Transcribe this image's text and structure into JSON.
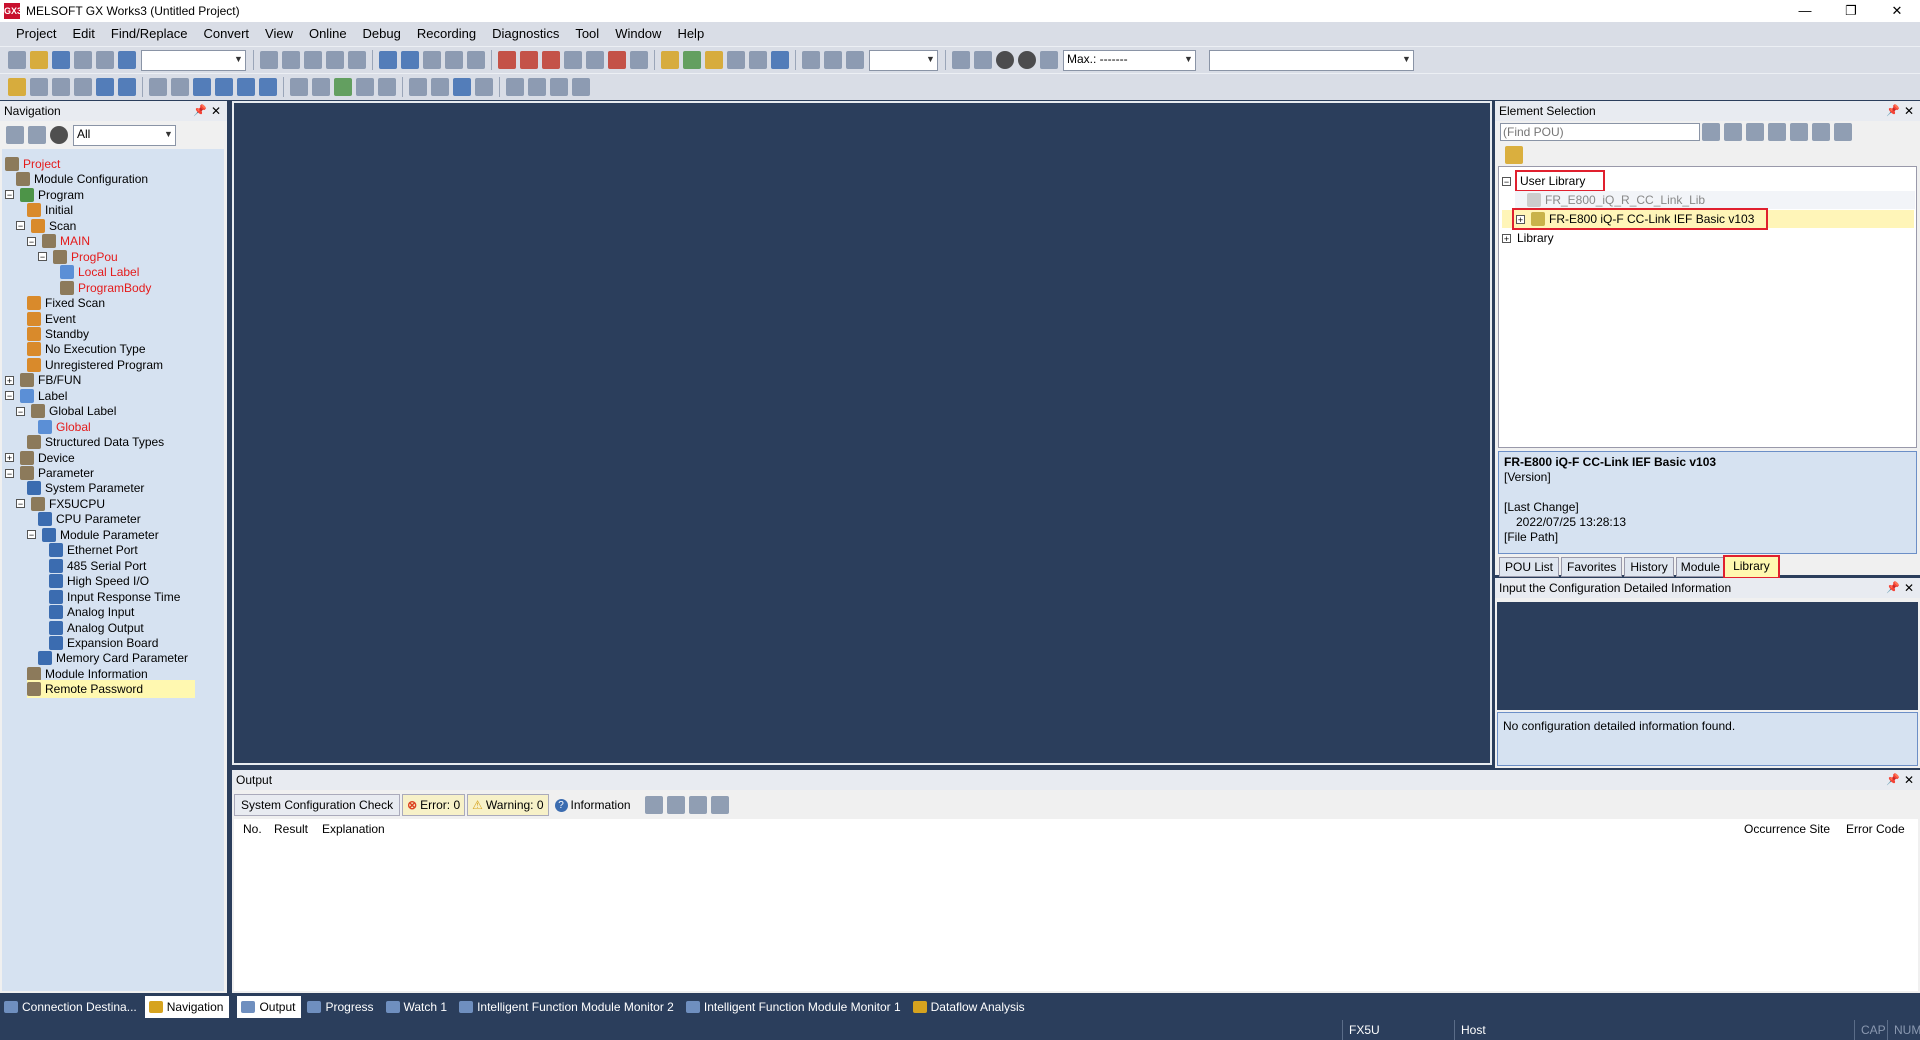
{
  "window": {
    "title": "MELSOFT GX Works3 (Untitled Project)",
    "app_icon": "GX3"
  },
  "menu": [
    "Project",
    "Edit",
    "Find/Replace",
    "Convert",
    "View",
    "Online",
    "Debug",
    "Recording",
    "Diagnostics",
    "Tool",
    "Window",
    "Help"
  ],
  "toolbar": {
    "monitor_label": "Max.: -------"
  },
  "navigation": {
    "title": "Navigation",
    "filter_value": "All",
    "tree": [
      {
        "label": "Project",
        "level": 0,
        "expander": "",
        "icon": "project-icon",
        "red": true
      },
      {
        "label": "Module Configuration",
        "level": 1,
        "expander": "",
        "icon": "module-config-icon",
        "red": false
      },
      {
        "label": "Program",
        "level": 0,
        "expander": "−",
        "icon": "program-icon",
        "red": false
      },
      {
        "label": "Initial",
        "level": 2,
        "expander": "",
        "icon": "folder-icon",
        "red": false
      },
      {
        "label": "Scan",
        "level": 1,
        "expander": "−",
        "icon": "folder-icon",
        "red": false
      },
      {
        "label": "MAIN",
        "level": 2,
        "expander": "−",
        "icon": "program-file-icon",
        "red": true
      },
      {
        "label": "ProgPou",
        "level": 3,
        "expander": "−",
        "icon": "pou-icon",
        "red": true
      },
      {
        "label": "Local Label",
        "level": 5,
        "expander": "",
        "icon": "label-icon",
        "red": true
      },
      {
        "label": "ProgramBody",
        "level": 5,
        "expander": "",
        "icon": "body-icon",
        "red": true
      },
      {
        "label": "Fixed Scan",
        "level": 2,
        "expander": "",
        "icon": "folder-icon",
        "red": false
      },
      {
        "label": "Event",
        "level": 2,
        "expander": "",
        "icon": "folder-icon",
        "red": false
      },
      {
        "label": "Standby",
        "level": 2,
        "expander": "",
        "icon": "folder-icon",
        "red": false
      },
      {
        "label": "No Execution Type",
        "level": 2,
        "expander": "",
        "icon": "folder-icon",
        "red": false
      },
      {
        "label": "Unregistered Program",
        "level": 2,
        "expander": "",
        "icon": "folder-icon",
        "red": false
      },
      {
        "label": "FB/FUN",
        "level": 0,
        "expander": "+",
        "icon": "fbfun-icon",
        "red": false
      },
      {
        "label": "Label",
        "level": 0,
        "expander": "−",
        "icon": "label-icon",
        "red": false
      },
      {
        "label": "Global Label",
        "level": 1,
        "expander": "−",
        "icon": "global-label-icon",
        "red": false
      },
      {
        "label": "Global",
        "level": 3,
        "expander": "",
        "icon": "label-icon",
        "red": true
      },
      {
        "label": "Structured Data Types",
        "level": 2,
        "expander": "",
        "icon": "struct-icon",
        "red": false
      },
      {
        "label": "Device",
        "level": 0,
        "expander": "+",
        "icon": "device-icon",
        "red": false
      },
      {
        "label": "Parameter",
        "level": 0,
        "expander": "−",
        "icon": "parameter-icon",
        "red": false
      },
      {
        "label": "System Parameter",
        "level": 2,
        "expander": "",
        "icon": "param-icon",
        "red": false
      },
      {
        "label": "FX5UCPU",
        "level": 1,
        "expander": "−",
        "icon": "cpu-icon",
        "red": false
      },
      {
        "label": "CPU Parameter",
        "level": 3,
        "expander": "",
        "icon": "param-icon",
        "red": false
      },
      {
        "label": "Module Parameter",
        "level": 2,
        "expander": "−",
        "icon": "param-icon",
        "red": false
      },
      {
        "label": "Ethernet Port",
        "level": 4,
        "expander": "",
        "icon": "param-icon",
        "red": false
      },
      {
        "label": "485 Serial Port",
        "level": 4,
        "expander": "",
        "icon": "param-icon",
        "red": false
      },
      {
        "label": "High Speed I/O",
        "level": 4,
        "expander": "",
        "icon": "param-icon",
        "red": false
      },
      {
        "label": "Input Response Time",
        "level": 4,
        "expander": "",
        "icon": "param-icon",
        "red": false
      },
      {
        "label": "Analog Input",
        "level": 4,
        "expander": "",
        "icon": "param-icon",
        "red": false
      },
      {
        "label": "Analog Output",
        "level": 4,
        "expander": "",
        "icon": "param-icon",
        "red": false
      },
      {
        "label": "Expansion Board",
        "level": 4,
        "expander": "",
        "icon": "param-icon",
        "red": false
      },
      {
        "label": "Memory Card Parameter",
        "level": 3,
        "expander": "",
        "icon": "param-icon",
        "red": false
      },
      {
        "label": "Module Information",
        "level": 2,
        "expander": "",
        "icon": "module-info-icon",
        "red": false
      },
      {
        "label": "Remote Password",
        "level": 2,
        "expander": "",
        "icon": "password-icon",
        "red": false,
        "selected": true
      }
    ]
  },
  "element_selection": {
    "title": "Element Selection",
    "find_placeholder": "(Find POU)",
    "tree": {
      "user_library": "User Library",
      "lib1": "FR_E800_iQ_R_CC_Link_Lib",
      "lib2": "FR-E800 iQ-F CC-Link IEF Basic v103",
      "library": "Library"
    },
    "info": {
      "name": "FR-E800 iQ-F CC-Link IEF Basic v103",
      "version_label": "[Version]",
      "last_change_label": "[Last Change]",
      "last_change_value": "2022/07/25 13:28:13",
      "file_path_label": "[File Path]"
    },
    "tabs": [
      "POU List",
      "Favorites",
      "History",
      "Module",
      "Library"
    ],
    "active_tab": "Library"
  },
  "config_panel": {
    "title": "Input the Configuration Detailed Information",
    "message": "No configuration detailed information found."
  },
  "output": {
    "title": "Output",
    "filter_label": "System Configuration Check",
    "error_label": "Error: 0",
    "warning_label": "Warning: 0",
    "info_label": "Information",
    "columns": [
      "No.",
      "Result",
      "Explanation",
      "Occurrence Site",
      "Error Code"
    ]
  },
  "bottom_tabs": [
    "Connection Destina...",
    "Navigation",
    "Output",
    "Progress",
    "Watch 1",
    "Intelligent Function Module Monitor 2",
    "Intelligent Function Module Monitor 1",
    "Dataflow Analysis"
  ],
  "status": {
    "cpu": "FX5U",
    "host": "Host",
    "cap": "CAP",
    "num": "NUM"
  },
  "colors": {
    "workspace": "#2b3e5c",
    "tree_bg": "#d6e2f1",
    "highlight": "#e0202e",
    "selected": "#fff8b0"
  }
}
